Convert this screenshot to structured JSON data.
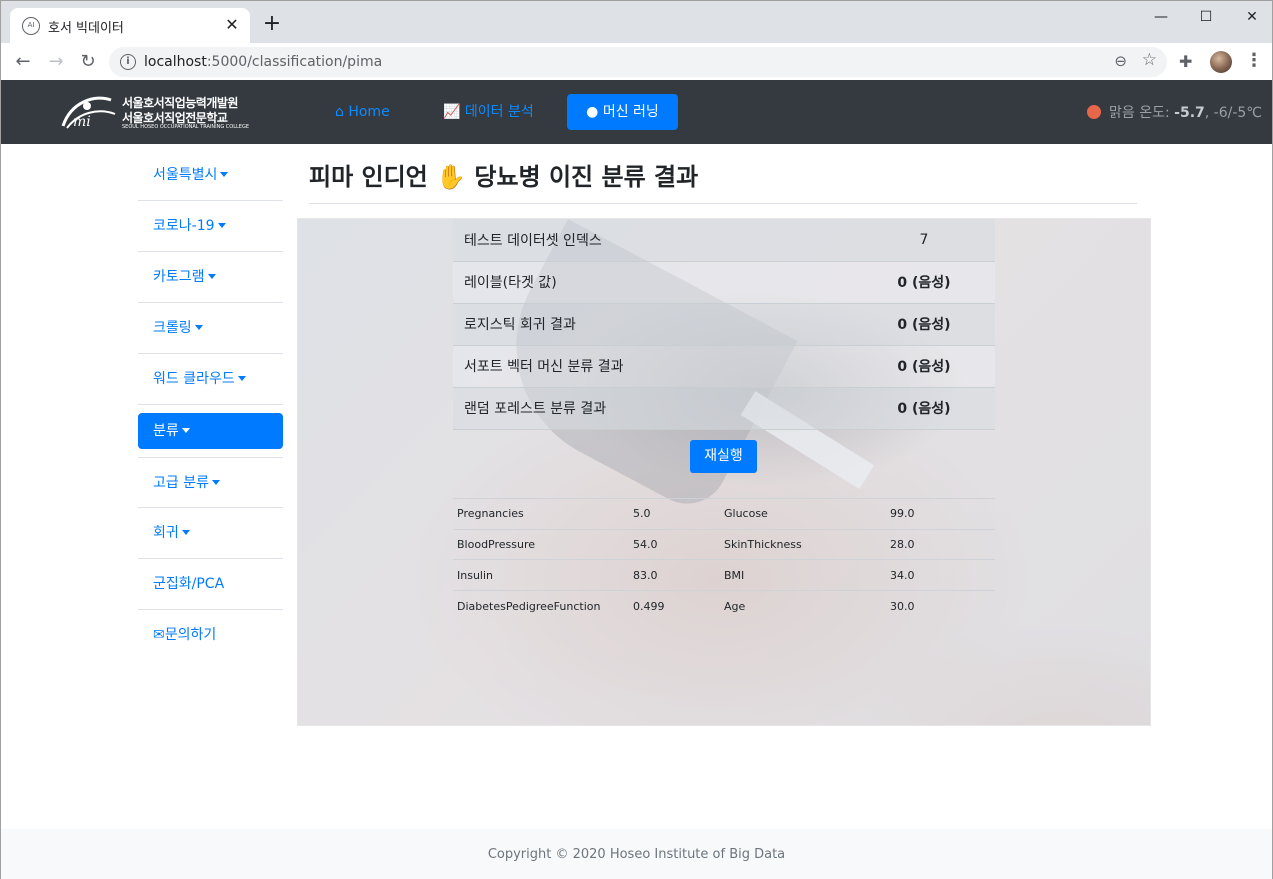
{
  "browser": {
    "tab_title": "호서 빅데이터",
    "favicon": "AI",
    "url_host": "localhost",
    "url_rest": ":5000/classification/pima"
  },
  "navbar": {
    "logo_line1": "서울호서직업능력개발원",
    "logo_line2": "서울호서직업전문학교",
    "logo_line3": "SEOUL HOSEO OCCUPATIONAL TRAINING COLLEGE",
    "home": "Home",
    "data_analysis": "데이터 분석",
    "machine_learning": "머신 러닝",
    "weather_label": "맑음 온도: ",
    "weather_temp": "-5.7",
    "weather_range": ", -6/-5℃"
  },
  "sidebar": {
    "items": [
      "서울특별시",
      "코로나-19",
      "카토그램",
      "크롤링",
      "워드 클라우드",
      "분류",
      "고급 분류",
      "회귀",
      "군집화/PCA",
      "문의하기"
    ]
  },
  "main": {
    "title_left": "피마 인디언",
    "title_right": "당뇨병 이진 분류 결과",
    "results": [
      {
        "label": "테스트 데이터셋 인덱스",
        "value": "7"
      },
      {
        "label": "레이블(타겟 값)",
        "value": "0 (음성)"
      },
      {
        "label": "로지스틱 회귀 결과",
        "value": "0 (음성)"
      },
      {
        "label": "서포트 벡터 머신 분류 결과",
        "value": "0 (음성)"
      },
      {
        "label": "랜덤 포레스트 분류 결과",
        "value": "0 (음성)"
      }
    ],
    "rerun_button": "재실행",
    "features": [
      {
        "n1": "Pregnancies",
        "v1": "5.0",
        "n2": "Glucose",
        "v2": "99.0"
      },
      {
        "n1": "BloodPressure",
        "v1": "54.0",
        "n2": "SkinThickness",
        "v2": "28.0"
      },
      {
        "n1": "Insulin",
        "v1": "83.0",
        "n2": "BMI",
        "v2": "34.0"
      },
      {
        "n1": "DiabetesPedigreeFunction",
        "v1": "0.499",
        "n2": "Age",
        "v2": "30.0"
      }
    ]
  },
  "footer": {
    "copyright": "Copyright © 2020 Hoseo Institute of Big Data"
  },
  "colors": {
    "primary": "#007bff",
    "navbar_bg": "#343a40",
    "weather_dot": "#e8664a"
  }
}
